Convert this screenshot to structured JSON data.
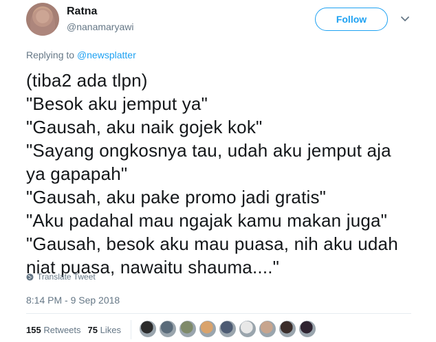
{
  "author": {
    "name": "Ratna",
    "handle": "@nanamaryawi"
  },
  "follow_label": "Follow",
  "reply": {
    "prefix": "Replying to ",
    "mention": "@newsplatter"
  },
  "tweet_lines": [
    "(tiba2 ada tlpn)",
    "\"Besok aku jemput ya\"",
    "\"Gausah, aku naik gojek kok\"",
    "\"Sayang ongkosnya tau, udah aku jemput aja",
    "ya gapapah\"",
    "\"Gausah, aku pake promo jadi gratis\"",
    "\"Aku padahal mau ngajak kamu makan juga\"",
    "\"Gausah, besok aku mau puasa, nih aku udah",
    "niat puasa, nawaitu shauma....\""
  ],
  "translate_label": "Translate Tweet",
  "timestamp": "8:14 PM - 9 Sep 2018",
  "stats": {
    "retweets_count": "155",
    "retweets_label": "Retweets",
    "likes_count": "75",
    "likes_label": "Likes"
  },
  "colors": {
    "accent": "#1da1f2",
    "muted": "#657786",
    "text": "#14171a"
  },
  "liker_avatar_colors": [
    "#2b2b2b",
    "#5a6b7a",
    "#7f8a6a",
    "#d9a36c",
    "#4d5b73",
    "#e8e8e8",
    "#c7a58e",
    "#3b2d2a",
    "#2e2330"
  ]
}
